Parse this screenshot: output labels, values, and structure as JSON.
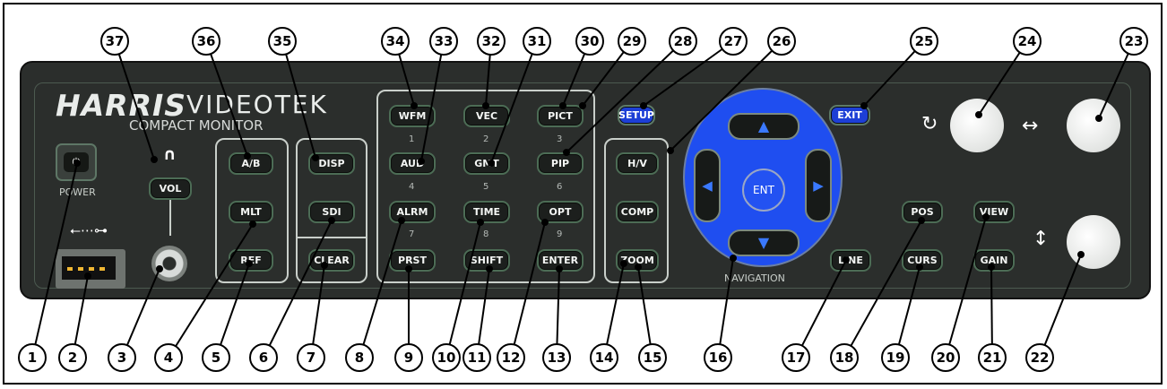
{
  "brand": {
    "name_a": "HARRIS",
    "name_b": "VIDEOTEK",
    "subtitle": "COMPACT MONITOR"
  },
  "controls": {
    "power_label": "POWER",
    "navigation_label": "NAVIGATION",
    "enter_label": "ENT",
    "headphone_icon": "headphone-icon",
    "usb_icon": "usb-icon"
  },
  "buttons": {
    "vol": "VOL",
    "ab": "A/B",
    "mlt": "MLT",
    "ref": "REF",
    "disp": "DISP",
    "sdi": "SDI",
    "clear": "CLEAR",
    "wfm": "WFM",
    "vec": "VEC",
    "pict": "PICT",
    "aud": "AUD",
    "gmt": "GMT",
    "pip": "PIP",
    "alrm": "ALRM",
    "time": "TIME",
    "opt": "OPT",
    "prst": "PRST",
    "shift": "SHIFT",
    "enter": "ENTER",
    "setup": "SETUP",
    "exit": "EXIT",
    "hv": "H/V",
    "comp": "COMP",
    "zoom": "ZOOM",
    "line": "LINE",
    "pos": "POS",
    "curs": "CURS",
    "view": "VIEW",
    "gain": "GAIN"
  },
  "keypad_digits": [
    "1",
    "2",
    "3",
    "4",
    "5",
    "6",
    "7",
    "8",
    "9"
  ],
  "callouts": [
    "1",
    "2",
    "3",
    "4",
    "5",
    "6",
    "7",
    "8",
    "9",
    "10",
    "11",
    "12",
    "13",
    "14",
    "15",
    "16",
    "17",
    "18",
    "19",
    "20",
    "21",
    "22",
    "23",
    "24",
    "25",
    "26",
    "27",
    "28",
    "29",
    "30",
    "31",
    "32",
    "33",
    "34",
    "35",
    "36",
    "37"
  ]
}
